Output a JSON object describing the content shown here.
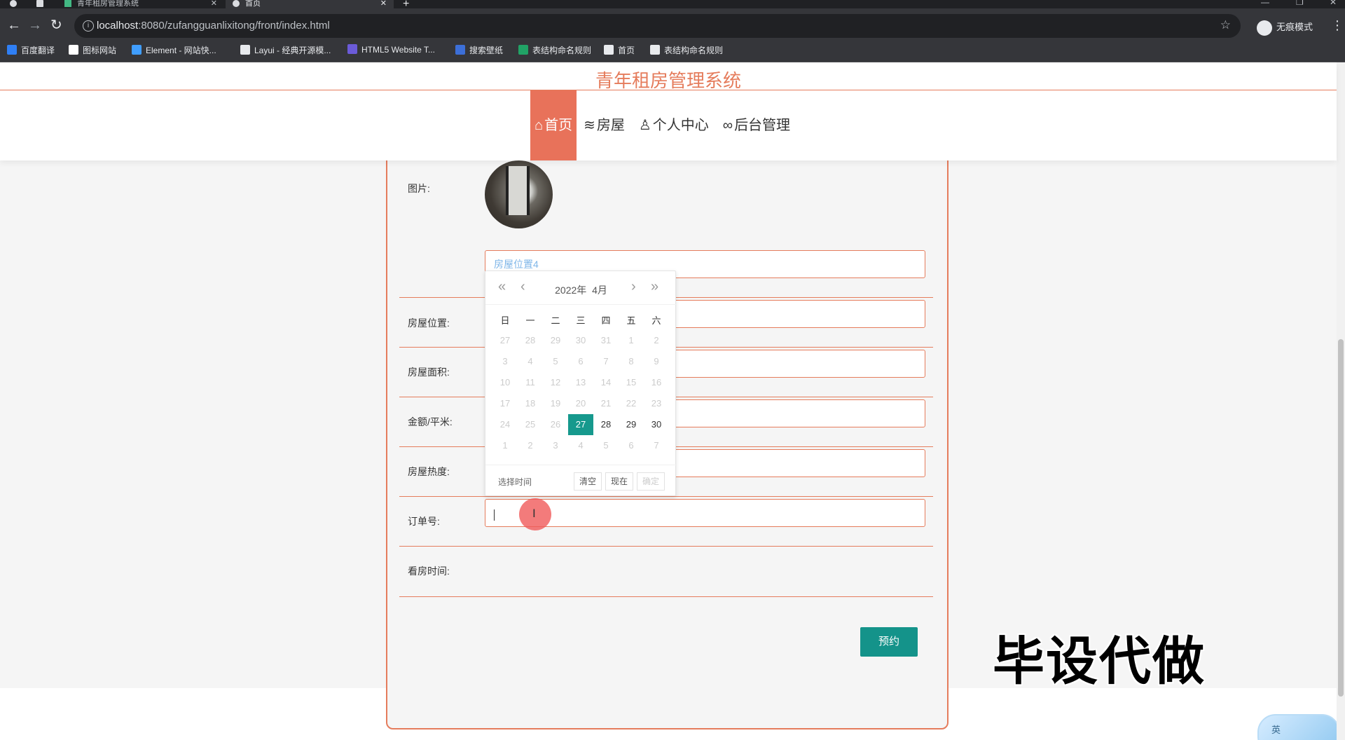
{
  "browser": {
    "tabs": [
      {
        "title": "青年租房管理系统"
      },
      {
        "title": "首页"
      }
    ],
    "new_tab": "+",
    "url_host": "localhost",
    "url_rest": ":8080/zufangguanlixitong/front/index.html",
    "incognito_label": "无痕模式",
    "bookmarks": [
      {
        "label": "百度翻译",
        "color": "#2f7ff5"
      },
      {
        "label": "图标网站",
        "color": "#ffffff"
      },
      {
        "label": "Element - 网站快...",
        "color": "#409eff"
      },
      {
        "label": "Layui - 经典开源模...",
        "color": "#e8eaed"
      },
      {
        "label": "HTML5 Website T...",
        "color": "#6b5bd9"
      },
      {
        "label": "搜索壁纸",
        "color": "#3c6fd8"
      },
      {
        "label": "表结构命名规则",
        "color": "#21a366"
      },
      {
        "label": "首页",
        "color": "#e8eaed"
      },
      {
        "label": "表结构命名规则",
        "color": "#e8eaed"
      }
    ]
  },
  "site": {
    "title": "青年租房管理系统",
    "nav": [
      {
        "icon": "⌂",
        "label": "首页",
        "active": true
      },
      {
        "icon": "≋",
        "label": "房屋",
        "active": false
      },
      {
        "icon": "♙",
        "label": "个人中心",
        "active": false
      },
      {
        "icon": "∞",
        "label": "后台管理",
        "active": false
      }
    ]
  },
  "form": {
    "image_label": "图片:",
    "location_label": "房屋位置:",
    "location_value": "房屋位置4",
    "area_label": "房屋面积:",
    "price_label": "金额/平米:",
    "heat_label": "房屋热度:",
    "order_label": "订单号:",
    "view_time_label": "看房时间:",
    "submit_label": "预约"
  },
  "datepicker": {
    "year_label": "2022年",
    "month_label": "4月",
    "weekdays": [
      "日",
      "一",
      "二",
      "三",
      "四",
      "五",
      "六"
    ],
    "days": [
      [
        "27",
        "28",
        "29",
        "30",
        "31",
        "1",
        "2"
      ],
      [
        "3",
        "4",
        "5",
        "6",
        "7",
        "8",
        "9"
      ],
      [
        "10",
        "11",
        "12",
        "13",
        "14",
        "15",
        "16"
      ],
      [
        "17",
        "18",
        "19",
        "20",
        "21",
        "22",
        "23"
      ],
      [
        "24",
        "25",
        "26",
        "27",
        "28",
        "29",
        "30"
      ],
      [
        "1",
        "2",
        "3",
        "4",
        "5",
        "6",
        "7"
      ]
    ],
    "current_month_days": [
      "27",
      "28",
      "29",
      "30"
    ],
    "selected": "27",
    "pick_time": "选择时间",
    "clear": "清空",
    "now": "现在",
    "confirm": "确定"
  },
  "overlay": {
    "watermark": "毕设代做",
    "ime_label": "英"
  },
  "colors": {
    "accent": "#e57c5c",
    "primary": "#14938a"
  }
}
